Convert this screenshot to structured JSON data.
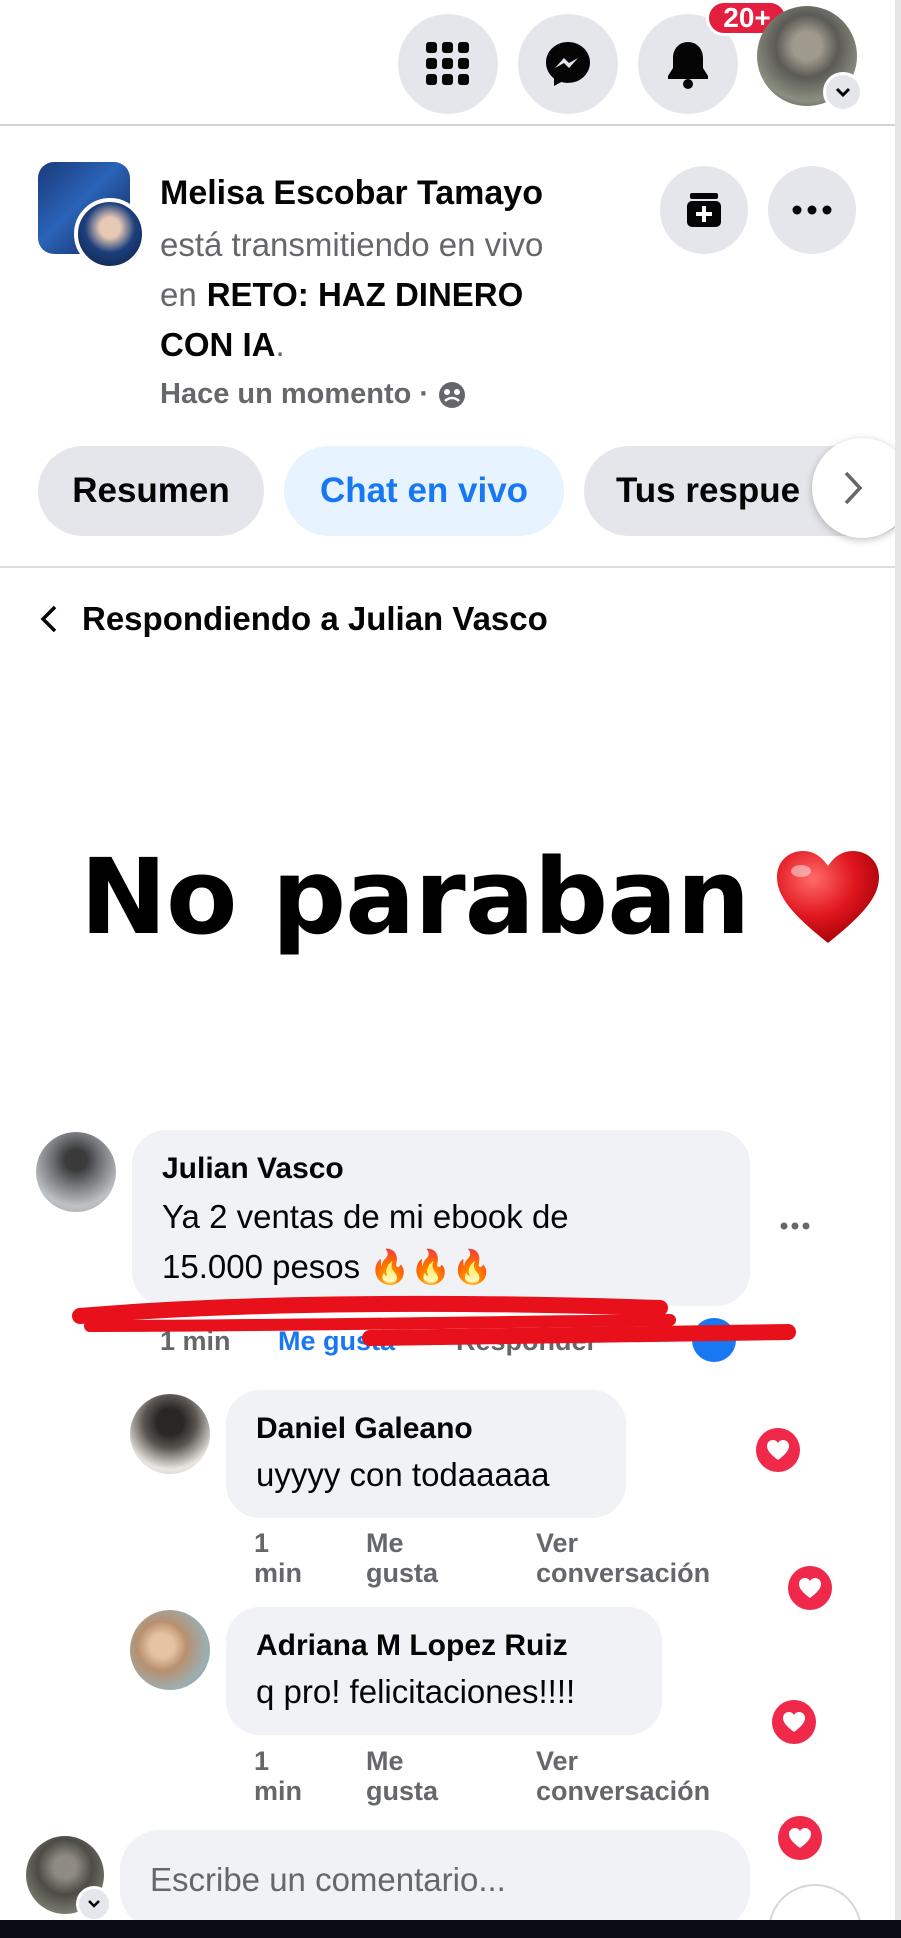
{
  "nav": {
    "notification_count": "20+",
    "icons": [
      "menu-grid-icon",
      "messenger-icon",
      "bell-icon"
    ]
  },
  "header": {
    "name": "Melisa Escobar Tamayo",
    "status_line": "está transmitiendo en vivo",
    "in_prefix": "en",
    "event_line1": "RETO: HAZ DINERO",
    "event_line2": "CON IA",
    "event_suffix": ".",
    "time": "Hace un momento",
    "time_separator": "·"
  },
  "tabs": [
    {
      "label": "Resumen",
      "active": false
    },
    {
      "label": "Chat en vivo",
      "active": true
    },
    {
      "label": "Tus respue",
      "active": false
    }
  ],
  "replying": {
    "label": "Respondiendo a Julian Vasco"
  },
  "overlay": {
    "text": "No paraban",
    "emoji": "heart-emoji"
  },
  "comments": [
    {
      "author": "Julian Vasco",
      "text_line1": "Ya 2 ventas de mi ebook de",
      "text_line2": "15.000 pesos",
      "emojis": "🔥🔥🔥",
      "time": "1 min",
      "like": "Me gusta",
      "reply": "Responder"
    },
    {
      "author": "Daniel Galeano",
      "text": "uyyyy con todaaaaa",
      "time_l1": "1",
      "time_l2": "min",
      "like_l1": "Me",
      "like_l2": "gusta",
      "view_l1": "Ver",
      "view_l2": "conversación"
    },
    {
      "author": "Adriana M Lopez Ruiz",
      "text": "q pro! felicitaciones!!!!",
      "time_l1": "1",
      "time_l2": "min",
      "like_l1": "Me",
      "like_l2": "gusta",
      "view_l1": "Ver",
      "view_l2": "conversación"
    }
  ],
  "composer": {
    "placeholder": "Escribe un comentario..."
  },
  "colors": {
    "accent": "#1877f2",
    "badge": "#e41e3f",
    "heart": "#f0284a",
    "underline": "#e8101a"
  }
}
